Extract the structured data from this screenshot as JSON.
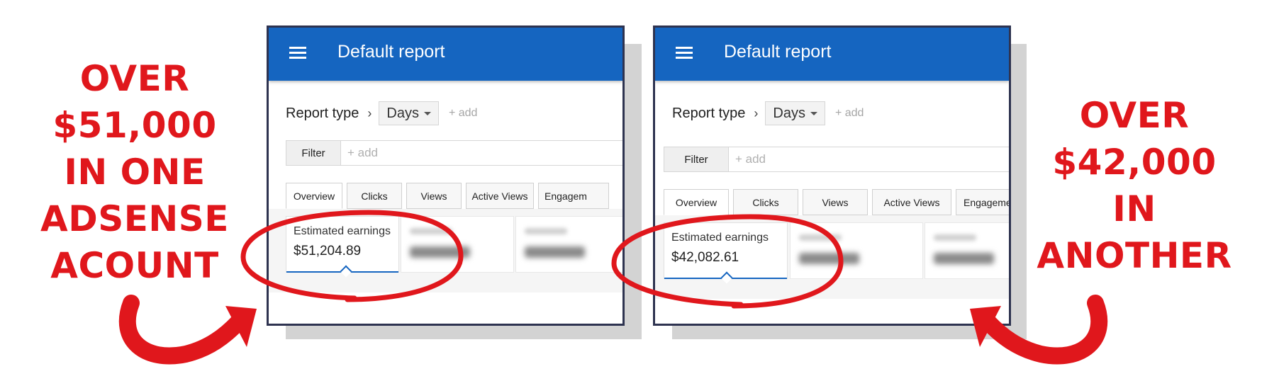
{
  "callouts": {
    "left": [
      "OVER",
      "$51,000",
      "IN ONE",
      "ADSENSE",
      "ACOUNT"
    ],
    "right": [
      "OVER",
      "$42,000",
      "IN",
      "ANOTHER"
    ]
  },
  "colors": {
    "accent_red": "#e0171c",
    "header_blue": "#1565c0"
  },
  "panels": [
    {
      "title": "Default report",
      "report_type_label": "Report type",
      "dimension": "Days",
      "add_label": "+ add",
      "filter_label": "Filter",
      "filter_placeholder": "+ add",
      "tabs": [
        "Overview",
        "Clicks",
        "Views",
        "Active Views",
        "Engagem"
      ],
      "metric_label": "Estimated earnings",
      "metric_value": "$51,204.89"
    },
    {
      "title": "Default report",
      "report_type_label": "Report type",
      "dimension": "Days",
      "add_label": "+ add",
      "filter_label": "Filter",
      "filter_placeholder": "+ add",
      "tabs": [
        "Overview",
        "Clicks",
        "Views",
        "Active Views",
        "Engageme"
      ],
      "metric_label": "Estimated earnings",
      "metric_value": "$42,082.61"
    }
  ]
}
